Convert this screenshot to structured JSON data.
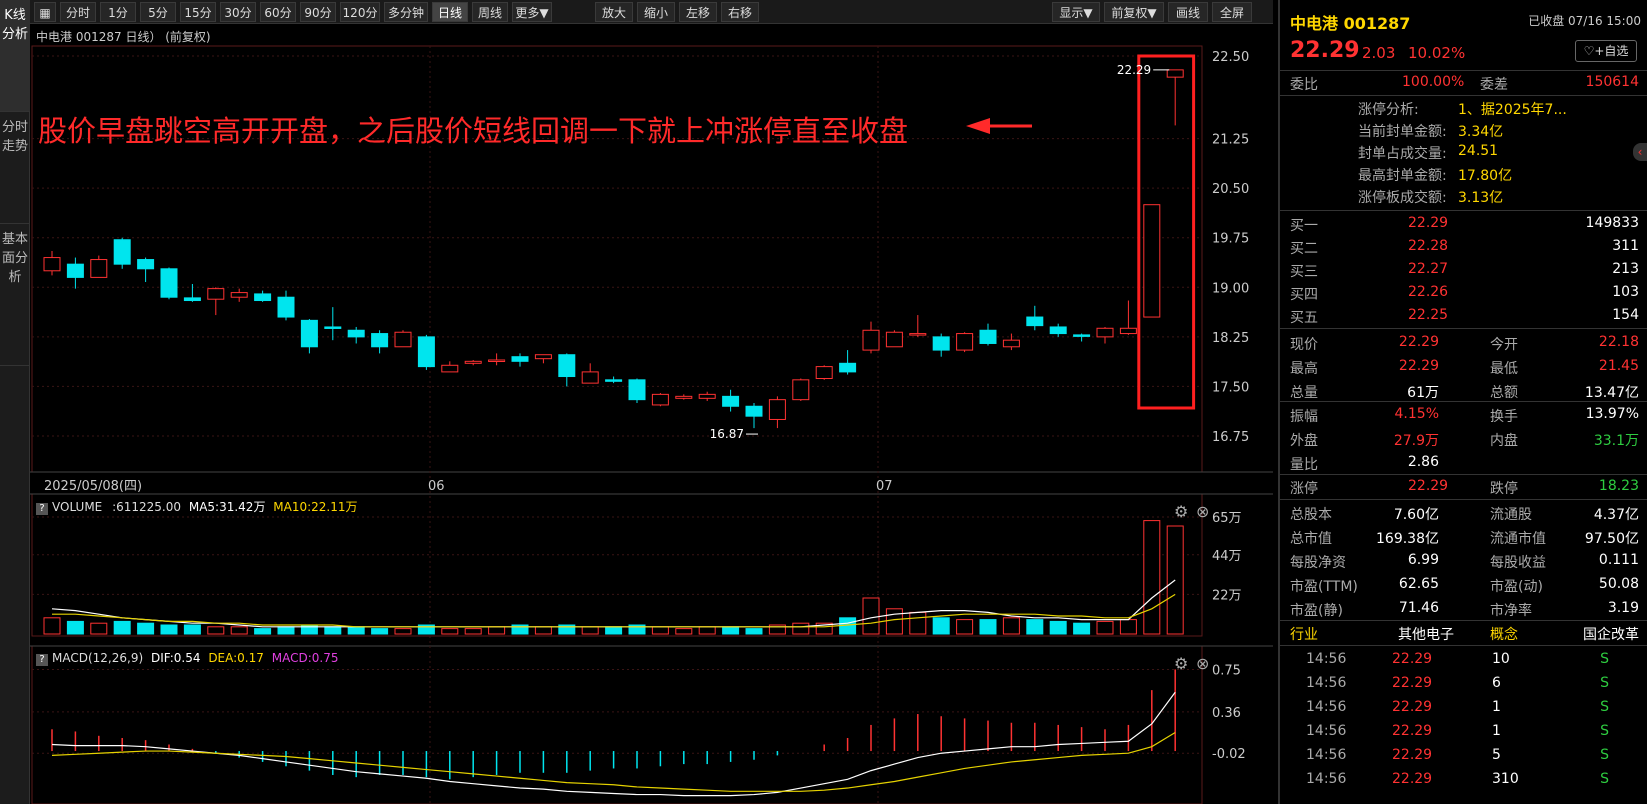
{
  "sidebar": {
    "tabs": [
      "K线分析",
      "分时走势",
      "基本面分析"
    ]
  },
  "toolbar": {
    "period_buttons": [
      "分时",
      "1分",
      "5分",
      "15分",
      "30分",
      "60分",
      "90分",
      "120分",
      "多分钟",
      "日线",
      "周线",
      "更多▼"
    ],
    "tool_buttons": [
      "放大",
      "缩小",
      "左移",
      "右移"
    ],
    "right_buttons": [
      "显示▼",
      "前复权▼",
      "画线",
      "全屏"
    ],
    "active": "日线"
  },
  "chart": {
    "panel_title": "中电港 001287 日线） (前复权)",
    "price_axis": [
      "22.50",
      "21.25",
      "20.50",
      "19.75",
      "19.00",
      "18.25",
      "17.50",
      "16.75"
    ],
    "date_labels": [
      "2025/05/08(四)",
      "06",
      "07"
    ],
    "annotation": "股价早盘跳空高开开盘，之后股价短线回调一下就上冲涨停直至收盘",
    "high_label": "22.29",
    "low_label": "16.87",
    "colors": {
      "up": "#ff3232",
      "down": "#00e5ee",
      "ma5": "#ffffff",
      "ma10": "#e5d200",
      "box": "#ff2020"
    },
    "candles": [
      {
        "o": 19.25,
        "h": 19.55,
        "l": 19.18,
        "c": 19.45
      },
      {
        "o": 19.35,
        "h": 19.45,
        "l": 18.98,
        "c": 19.15
      },
      {
        "o": 19.15,
        "h": 19.48,
        "l": 19.15,
        "c": 19.42
      },
      {
        "o": 19.72,
        "h": 19.75,
        "l": 19.28,
        "c": 19.35
      },
      {
        "o": 19.42,
        "h": 19.45,
        "l": 19.08,
        "c": 19.28
      },
      {
        "o": 19.28,
        "h": 19.3,
        "l": 18.82,
        "c": 18.85
      },
      {
        "o": 18.84,
        "h": 19.05,
        "l": 18.78,
        "c": 18.8
      },
      {
        "o": 18.82,
        "h": 19.0,
        "l": 18.58,
        "c": 18.98
      },
      {
        "o": 18.85,
        "h": 18.98,
        "l": 18.78,
        "c": 18.92
      },
      {
        "o": 18.9,
        "h": 18.95,
        "l": 18.78,
        "c": 18.8
      },
      {
        "o": 18.85,
        "h": 18.95,
        "l": 18.5,
        "c": 18.55
      },
      {
        "o": 18.5,
        "h": 18.52,
        "l": 18.0,
        "c": 18.1
      },
      {
        "o": 18.4,
        "h": 18.7,
        "l": 18.2,
        "c": 18.38
      },
      {
        "o": 18.35,
        "h": 18.4,
        "l": 18.15,
        "c": 18.25
      },
      {
        "o": 18.3,
        "h": 18.35,
        "l": 18.0,
        "c": 18.1
      },
      {
        "o": 18.1,
        "h": 18.35,
        "l": 18.1,
        "c": 18.32
      },
      {
        "o": 18.25,
        "h": 18.28,
        "l": 17.75,
        "c": 17.8
      },
      {
        "o": 17.72,
        "h": 17.88,
        "l": 17.72,
        "c": 17.82
      },
      {
        "o": 17.85,
        "h": 17.9,
        "l": 17.82,
        "c": 17.88
      },
      {
        "o": 17.88,
        "h": 18.0,
        "l": 17.82,
        "c": 17.9
      },
      {
        "o": 17.95,
        "h": 18.0,
        "l": 17.8,
        "c": 17.88
      },
      {
        "o": 17.92,
        "h": 17.98,
        "l": 17.85,
        "c": 17.98
      },
      {
        "o": 17.98,
        "h": 18.0,
        "l": 17.5,
        "c": 17.65
      },
      {
        "o": 17.55,
        "h": 17.85,
        "l": 17.55,
        "c": 17.72
      },
      {
        "o": 17.6,
        "h": 17.65,
        "l": 17.55,
        "c": 17.58
      },
      {
        "o": 17.6,
        "h": 17.62,
        "l": 17.25,
        "c": 17.3
      },
      {
        "o": 17.22,
        "h": 17.4,
        "l": 17.2,
        "c": 17.38
      },
      {
        "o": 17.32,
        "h": 17.38,
        "l": 17.3,
        "c": 17.35
      },
      {
        "o": 17.32,
        "h": 17.42,
        "l": 17.28,
        "c": 17.38
      },
      {
        "o": 17.35,
        "h": 17.45,
        "l": 17.12,
        "c": 17.2
      },
      {
        "o": 17.2,
        "h": 17.25,
        "l": 16.87,
        "c": 17.05
      },
      {
        "o": 17.0,
        "h": 17.35,
        "l": 16.87,
        "c": 17.3
      },
      {
        "o": 17.3,
        "h": 17.62,
        "l": 17.28,
        "c": 17.6
      },
      {
        "o": 17.62,
        "h": 17.82,
        "l": 17.6,
        "c": 17.8
      },
      {
        "o": 17.85,
        "h": 18.05,
        "l": 17.68,
        "c": 17.72
      },
      {
        "o": 18.05,
        "h": 18.48,
        "l": 18.0,
        "c": 18.35
      },
      {
        "o": 18.1,
        "h": 18.35,
        "l": 18.1,
        "c": 18.32
      },
      {
        "o": 18.3,
        "h": 18.58,
        "l": 18.25,
        "c": 18.3
      },
      {
        "o": 18.25,
        "h": 18.3,
        "l": 17.95,
        "c": 18.05
      },
      {
        "o": 18.05,
        "h": 18.32,
        "l": 18.02,
        "c": 18.3
      },
      {
        "o": 18.35,
        "h": 18.45,
        "l": 18.12,
        "c": 18.15
      },
      {
        "o": 18.1,
        "h": 18.3,
        "l": 18.05,
        "c": 18.2
      },
      {
        "o": 18.55,
        "h": 18.72,
        "l": 18.35,
        "c": 18.42
      },
      {
        "o": 18.4,
        "h": 18.45,
        "l": 18.25,
        "c": 18.3
      },
      {
        "o": 18.28,
        "h": 18.3,
        "l": 18.18,
        "c": 18.26
      },
      {
        "o": 18.25,
        "h": 18.4,
        "l": 18.15,
        "c": 18.38
      },
      {
        "o": 18.3,
        "h": 18.8,
        "l": 18.28,
        "c": 18.38
      },
      {
        "o": 18.55,
        "h": 20.25,
        "l": 18.55,
        "c": 20.25
      },
      {
        "o": 22.18,
        "h": 22.29,
        "l": 21.45,
        "c": 22.29
      }
    ],
    "ma_price5": [
      19.2,
      19.15,
      19.1,
      19.05,
      19.0,
      18.98,
      18.95,
      18.9,
      18.88,
      18.82,
      18.72,
      18.6,
      18.5,
      18.4,
      18.3,
      18.22,
      18.12,
      18.05,
      17.98,
      17.95,
      17.9,
      17.85,
      17.8,
      17.75,
      17.7,
      17.6,
      17.5,
      17.45,
      17.4,
      17.35,
      17.3,
      17.3,
      17.38,
      17.5,
      17.65,
      17.85,
      18.0,
      18.15,
      18.2,
      18.25,
      18.22,
      18.2,
      18.25,
      18.28,
      18.3,
      18.3,
      18.35,
      18.75,
      19.4
    ]
  },
  "volume": {
    "title_label": "VOLUME",
    "value_text": ":611225.00",
    "ma5_text": "MA5:31.42万",
    "ma10_text": "MA10:22.11万",
    "axis": [
      "65万",
      "44万",
      "22万"
    ],
    "bars": [
      9,
      7,
      6,
      7,
      6,
      5,
      5,
      4,
      4,
      3,
      4,
      5,
      4,
      4,
      3,
      3,
      5,
      3,
      3,
      4,
      5,
      4,
      5,
      4,
      4,
      5,
      4,
      3,
      4,
      4,
      3,
      5,
      6,
      6,
      9,
      20,
      14,
      12,
      9,
      8,
      8,
      9,
      8,
      7,
      6,
      7,
      8,
      63,
      60
    ],
    "ma5": [
      14,
      13,
      11,
      9,
      8,
      7,
      6,
      6,
      5,
      4,
      4,
      4,
      4,
      4,
      4,
      4,
      4,
      4,
      4,
      4,
      4,
      4,
      4,
      4,
      4,
      4,
      4,
      4,
      4,
      4,
      4,
      4,
      4,
      5,
      6,
      9,
      11,
      12,
      13,
      13,
      12,
      10,
      9,
      9,
      8,
      8,
      8,
      20,
      30
    ],
    "ma10": [
      11,
      11,
      10,
      9,
      8,
      7,
      7,
      6,
      6,
      5,
      5,
      5,
      5,
      4,
      4,
      4,
      4,
      4,
      4,
      4,
      4,
      4,
      4,
      4,
      4,
      4,
      4,
      4,
      4,
      4,
      4,
      4,
      4,
      4,
      5,
      6,
      8,
      9,
      10,
      11,
      11,
      11,
      11,
      10,
      10,
      9,
      9,
      14,
      22
    ]
  },
  "macd": {
    "title": "MACD(12,26,9)",
    "dif_text": "DIF:0.54",
    "dea_text": "DEA:0.17",
    "macd_text": "MACD:0.75",
    "axis": [
      "0.75",
      "0.36",
      "-0.02"
    ],
    "hist": [
      0.2,
      0.18,
      0.14,
      0.12,
      0.1,
      0.06,
      0.02,
      -0.02,
      -0.06,
      -0.1,
      -0.14,
      -0.18,
      -0.22,
      -0.24,
      -0.22,
      -0.22,
      -0.24,
      -0.26,
      -0.24,
      -0.22,
      -0.2,
      -0.2,
      -0.2,
      -0.18,
      -0.16,
      -0.16,
      -0.14,
      -0.12,
      -0.12,
      -0.1,
      -0.08,
      -0.04,
      0.0,
      0.06,
      0.12,
      0.24,
      0.3,
      0.34,
      0.32,
      0.3,
      0.28,
      0.26,
      0.26,
      0.24,
      0.22,
      0.2,
      0.24,
      0.56,
      0.75
    ],
    "dif": [
      0.06,
      0.05,
      0.05,
      0.05,
      0.04,
      0.02,
      0.0,
      -0.02,
      -0.04,
      -0.07,
      -0.1,
      -0.13,
      -0.16,
      -0.19,
      -0.21,
      -0.23,
      -0.25,
      -0.28,
      -0.3,
      -0.32,
      -0.34,
      -0.35,
      -0.37,
      -0.38,
      -0.39,
      -0.4,
      -0.4,
      -0.41,
      -0.41,
      -0.41,
      -0.4,
      -0.38,
      -0.34,
      -0.3,
      -0.26,
      -0.18,
      -0.12,
      -0.06,
      -0.02,
      0.0,
      0.02,
      0.04,
      0.04,
      0.06,
      0.07,
      0.08,
      0.09,
      0.25,
      0.54
    ],
    "dea": [
      -0.04,
      -0.03,
      -0.02,
      -0.01,
      0.0,
      0.0,
      -0.01,
      -0.02,
      -0.03,
      -0.04,
      -0.05,
      -0.07,
      -0.09,
      -0.11,
      -0.13,
      -0.15,
      -0.17,
      -0.19,
      -0.21,
      -0.23,
      -0.25,
      -0.27,
      -0.29,
      -0.3,
      -0.31,
      -0.33,
      -0.34,
      -0.35,
      -0.36,
      -0.37,
      -0.37,
      -0.37,
      -0.37,
      -0.36,
      -0.34,
      -0.31,
      -0.28,
      -0.24,
      -0.2,
      -0.16,
      -0.13,
      -0.1,
      -0.08,
      -0.06,
      -0.04,
      -0.03,
      -0.02,
      0.04,
      0.17
    ]
  },
  "quote": {
    "name": "中电港 001287",
    "status": "已收盘 07/16 15:00",
    "price": "22.29",
    "change": "2.03",
    "pct": "10.02%",
    "watch_button": "♡+自选",
    "weibi_label": "委比",
    "weibi": "100.00%",
    "weicha_label": "委差",
    "weicha": "150614",
    "limit_analysis": [
      {
        "label": "涨停分析:",
        "value": "1、据2025年7..."
      },
      {
        "label": "当前封单金额:",
        "value": "3.34亿"
      },
      {
        "label": "封单占成交量:",
        "value": "24.51"
      },
      {
        "label": "最高封单金额:",
        "value": "17.80亿"
      },
      {
        "label": "涨停板成交额:",
        "value": "3.13亿"
      }
    ],
    "bids": [
      {
        "label": "买一",
        "price": "22.29",
        "vol": "149833"
      },
      {
        "label": "买二",
        "price": "22.28",
        "vol": "311"
      },
      {
        "label": "买三",
        "price": "22.27",
        "vol": "213"
      },
      {
        "label": "买四",
        "price": "22.26",
        "vol": "103"
      },
      {
        "label": "买五",
        "price": "22.25",
        "vol": "154"
      }
    ],
    "stats1": [
      {
        "l1": "现价",
        "v1": "22.29",
        "c1": "red",
        "l2": "今开",
        "v2": "22.18",
        "c2": "red"
      },
      {
        "l1": "最高",
        "v1": "22.29",
        "c1": "red",
        "l2": "最低",
        "v2": "21.45",
        "c2": "red"
      },
      {
        "l1": "总量",
        "v1": "61万",
        "c1": "white",
        "l2": "总额",
        "v2": "13.47亿",
        "c2": "white"
      }
    ],
    "stats2": [
      {
        "l1": "振幅",
        "v1": "4.15%",
        "c1": "red",
        "l2": "换手",
        "v2": "13.97%",
        "c2": "white"
      },
      {
        "l1": "外盘",
        "v1": "27.9万",
        "c1": "red",
        "l2": "内盘",
        "v2": "33.1万",
        "c2": "green"
      },
      {
        "l1": "量比",
        "v1": "2.86",
        "c1": "white",
        "l2": "",
        "v2": "",
        "c2": "white"
      }
    ],
    "limits": {
      "l1": "涨停",
      "v1": "22.29",
      "l2": "跌停",
      "v2": "18.23"
    },
    "fundamentals": [
      {
        "l1": "总股本",
        "v1": "7.60亿",
        "l2": "流通股",
        "v2": "4.37亿"
      },
      {
        "l1": "总市值",
        "v1": "169.38亿",
        "l2": "流通市值",
        "v2": "97.50亿"
      },
      {
        "l1": "每股净资",
        "v1": "6.99",
        "l2": "每股收益",
        "v2": "0.111"
      },
      {
        "l1": "市盈(TTM)",
        "v1": "62.65",
        "l2": "市盈(动)",
        "v2": "50.08"
      },
      {
        "l1": "市盈(静)",
        "v1": "71.46",
        "l2": "市净率",
        "v2": "3.19"
      }
    ],
    "industry": {
      "l1": "行业",
      "v1": "其他电子",
      "l2": "概念",
      "v2": "国企改革"
    },
    "ticks": [
      {
        "time": "14:56",
        "price": "22.29",
        "vol": "10",
        "flag": "S"
      },
      {
        "time": "14:56",
        "price": "22.29",
        "vol": "6",
        "flag": "S"
      },
      {
        "time": "14:56",
        "price": "22.29",
        "vol": "1",
        "flag": "S"
      },
      {
        "time": "14:56",
        "price": "22.29",
        "vol": "1",
        "flag": "S"
      },
      {
        "time": "14:56",
        "price": "22.29",
        "vol": "5",
        "flag": "S"
      },
      {
        "time": "14:56",
        "price": "22.29",
        "vol": "310",
        "flag": "S"
      }
    ]
  }
}
